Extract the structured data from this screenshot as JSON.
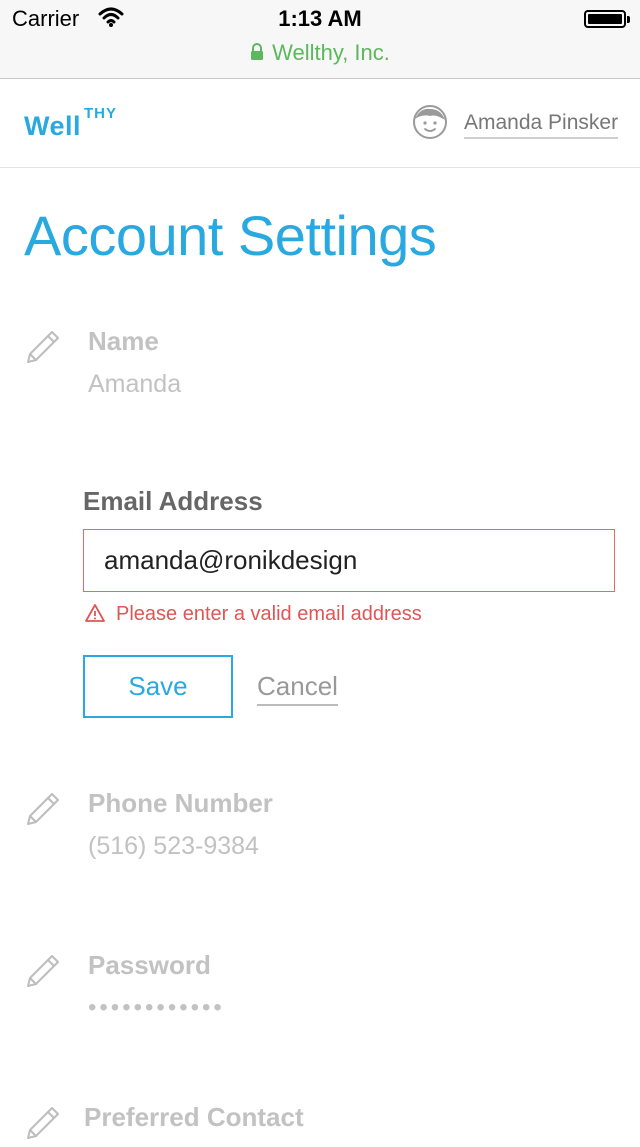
{
  "status_bar": {
    "carrier": "Carrier",
    "time": "1:13 AM",
    "site_name": "Wellthy, Inc.",
    "site_color": "#5cb85c",
    "icons": [
      "wifi-icon",
      "battery-icon",
      "lock-icon"
    ]
  },
  "header": {
    "logo_main": "Well",
    "logo_sup": "THY",
    "brand_color": "#29a9e0",
    "user_name": "Amanda Pinsker",
    "avatar_icon": "avatar-face-icon"
  },
  "page": {
    "title": "Account Settings"
  },
  "fields": {
    "name": {
      "label": "Name",
      "value": "Amanda",
      "icon": "pencil-icon"
    },
    "email": {
      "label": "Email Address",
      "value": "amanda@ronikdesign",
      "error": "Please enter a valid email address",
      "error_color": "#e05555",
      "error_icon": "warning-icon",
      "save_label": "Save",
      "cancel_label": "Cancel"
    },
    "phone": {
      "label": "Phone Number",
      "value": "(516) 523-9384",
      "icon": "pencil-icon"
    },
    "password": {
      "label": "Password",
      "value": "••••••••••••",
      "icon": "pencil-icon"
    },
    "preferred_contact": {
      "label": "Preferred Contact",
      "icon": "pencil-icon"
    }
  }
}
